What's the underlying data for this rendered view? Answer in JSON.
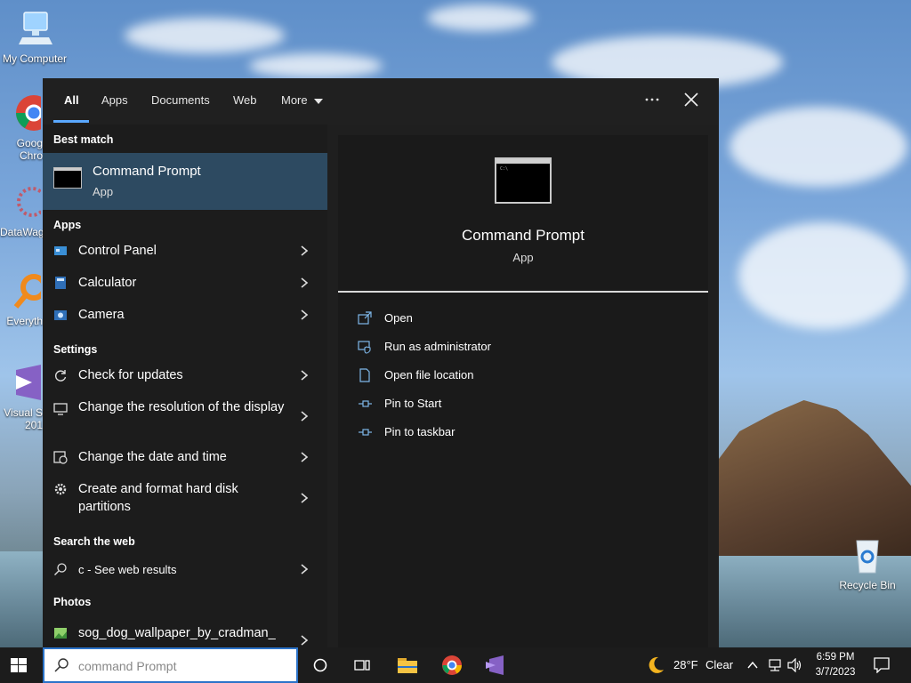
{
  "desktop": {
    "icons": [
      {
        "label": "My Computer"
      },
      {
        "label": "Goog Chro"
      },
      {
        "label": "DataWag"
      },
      {
        "label": "Everyth"
      },
      {
        "label": "Visual S 201"
      },
      {
        "label": "Recycle Bin"
      }
    ]
  },
  "search_panel": {
    "tabs": [
      {
        "label": "All",
        "active": true
      },
      {
        "label": "Apps"
      },
      {
        "label": "Documents"
      },
      {
        "label": "Web"
      },
      {
        "label": "More"
      }
    ],
    "more_options_icon": "ellipsis-icon",
    "close_icon": "close-icon",
    "best_match": {
      "heading": "Best match",
      "title": "Command Prompt",
      "subtitle": "App"
    },
    "sections": {
      "apps": "Apps",
      "settings": "Settings",
      "search_web": "Search the web",
      "photos": "Photos"
    },
    "apps": [
      {
        "label": "Control Panel",
        "icon": "control-panel-icon"
      },
      {
        "label": "Calculator",
        "icon": "calculator-icon"
      },
      {
        "label": "Camera",
        "icon": "camera-icon"
      }
    ],
    "settings": [
      {
        "label": "Check for updates",
        "icon": "refresh-icon"
      },
      {
        "label": "Change the resolution of the display",
        "icon": "monitor-icon"
      },
      {
        "label": "Change the date and time",
        "icon": "calendar-clock-icon"
      },
      {
        "label": "Create and format hard disk partitions",
        "icon": "gear-icon"
      }
    ],
    "web": {
      "label": "c - See web results",
      "icon": "search-icon"
    },
    "photos": [
      {
        "label": "sog_dog_wallpaper_by_cradman_",
        "icon": "image-icon"
      }
    ],
    "preview": {
      "title": "Command Prompt",
      "subtitle": "App",
      "actions": [
        {
          "label": "Open",
          "icon": "open-icon"
        },
        {
          "label": "Run as administrator",
          "icon": "shield-icon"
        },
        {
          "label": "Open file location",
          "icon": "file-location-icon"
        },
        {
          "label": "Pin to Start",
          "icon": "pin-icon"
        },
        {
          "label": "Pin to taskbar",
          "icon": "pin-icon"
        }
      ]
    }
  },
  "taskbar": {
    "search_value": "command Prompt",
    "weather": {
      "temp": "28°F",
      "condition": "Clear"
    },
    "clock": {
      "time": "6:59 PM",
      "date": "3/7/2023"
    }
  },
  "colors": {
    "accent": "#5aa8ff",
    "best_match_bg": "#2d4a61",
    "panel_bg": "#1f1f1f",
    "taskbar_bg": "#1c1c1c"
  }
}
